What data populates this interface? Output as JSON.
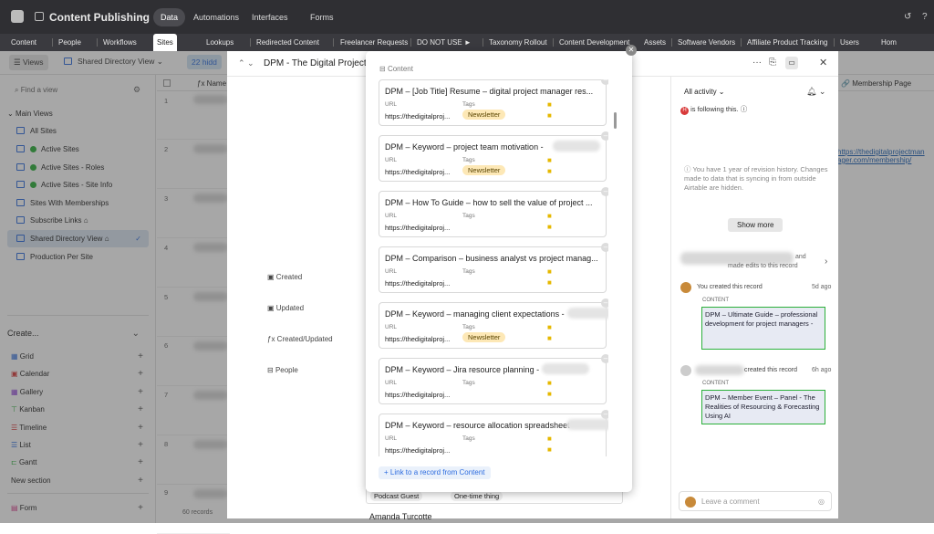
{
  "app": {
    "title": "Content Publishing",
    "nav": [
      "Data",
      "Automations",
      "Interfaces",
      "Forms"
    ],
    "active_nav": "Data"
  },
  "tabs": [
    "Content",
    "People",
    "Workflows",
    "Sites",
    "Lookups",
    "Redirected Content",
    "Freelancer Requests",
    "DO NOT USE ►",
    "Taxonomy Rollout",
    "Content Development",
    "Assets",
    "Software Vendors",
    "Affiliate Product Tracking",
    "Users",
    "Hom"
  ],
  "toolbar": {
    "views": "Views",
    "view_name": "Shared Directory View",
    "hidden": "22 hidd"
  },
  "sidebar": {
    "search_placeholder": "Find a view",
    "section": "Main Views",
    "views": [
      "All Sites",
      "Active Sites",
      "Active Sites - Roles",
      "Active Sites - Site Info",
      "Sites With Memberships",
      "Subscribe Links",
      "Shared Directory View",
      "Production Per Site"
    ],
    "create_label": "Create...",
    "create_items": [
      "Grid",
      "Calendar",
      "Gallery",
      "Kanban",
      "Timeline",
      "List",
      "Gantt",
      "New section",
      "Form"
    ]
  },
  "grid": {
    "name_header": "Name",
    "membership_header": "Membership Page",
    "row_numbers": [
      "1",
      "2",
      "3",
      "4",
      "5",
      "6",
      "7",
      "8",
      "9"
    ],
    "records_count": "60 records",
    "membership_link_1": "https://thedigitalprojectman",
    "membership_link_2": "ager.com/membership/"
  },
  "record": {
    "title": "DPM - The Digital Project M",
    "fields": [
      "Created",
      "Updated",
      "Created/Updated",
      "People"
    ],
    "bottom_chips": [
      "Podcast Guest",
      "One-time thing"
    ],
    "bottom_name": "Amanda Turcotte"
  },
  "activity": {
    "filter": "All activity",
    "following": "is following this.",
    "revision_note": "You have 1 year of revision history. Changes made to data that is syncing in from outside Airtable are hidden.",
    "show_more": "Show more",
    "edit_and": "and",
    "edit_text": "made edits to this record",
    "entry1_text": "You created this record",
    "entry1_time": "5d ago",
    "entry1_label": "CONTENT",
    "entry1_content": "DPM – Ultimate Guide – professional development for project managers -",
    "entry2_text": "created this record",
    "entry2_time": "6h ago",
    "entry2_label": "CONTENT",
    "entry2_content": "DPM – Member Event – Panel - The Realities of Resourcing & Forecasting Using AI",
    "comment_placeholder": "Leave a comment"
  },
  "modal": {
    "title": "Content",
    "url_label": "URL",
    "tags_label": "Tags",
    "link_button": "+ Link to a record from Content",
    "cards": [
      {
        "title": "DPM – [Job Title] Resume – digital project manager res...",
        "url": "https://thedigitalproj...",
        "tag": "Newsletter"
      },
      {
        "title": "DPM – Keyword – project team motivation -",
        "url": "https://thedigitalproj...",
        "tag": "Newsletter"
      },
      {
        "title": "DPM – How To Guide – how to sell the value of project ...",
        "url": "https://thedigitalproj...",
        "tag": ""
      },
      {
        "title": "DPM – Comparison – business analyst vs project manag...",
        "url": "https://thedigitalproj...",
        "tag": ""
      },
      {
        "title": "DPM – Keyword – managing client expectations -",
        "url": "https://thedigitalproj...",
        "tag": "Newsletter"
      },
      {
        "title": "DPM – Keyword – Jira resource planning -",
        "url": "https://thedigitalproj...",
        "tag": ""
      },
      {
        "title": "DPM – Keyword – resource allocation spreadsheet -",
        "url": "https://thedigitalproj...",
        "tag": ""
      }
    ]
  }
}
